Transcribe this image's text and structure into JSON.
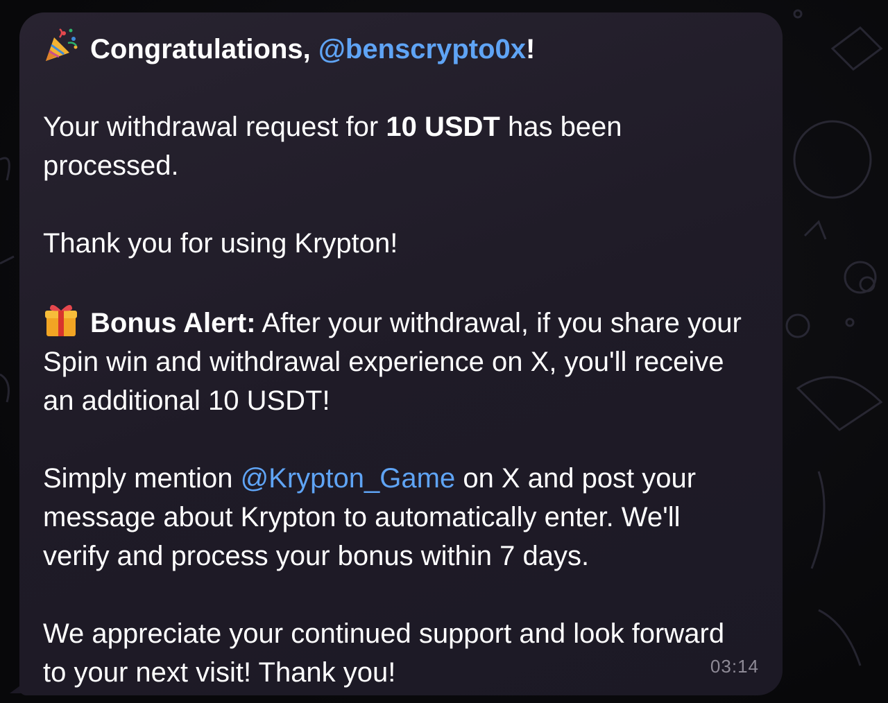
{
  "message": {
    "title": {
      "emoji": "party-popper-icon",
      "prefix": "Congratulations, ",
      "mention": "@benscrypto0x",
      "suffix": "!"
    },
    "withdrawal": {
      "prefix": "Your withdrawal request for ",
      "amount": "10 USDT",
      "suffix": " has been processed."
    },
    "thanks": "Thank you for using Krypton!",
    "bonus": {
      "emoji": "gift-icon",
      "label": "Bonus Alert:",
      "text": " After your withdrawal, if you share your Spin win and withdrawal experience on X, you'll receive an additional 10 USDT!"
    },
    "mention_para": {
      "prefix": "Simply mention ",
      "mention": "@Krypton_Game",
      "suffix": " on X and post your message about Krypton to automatically enter. We'll verify and process your bonus within 7 days."
    },
    "closing": "We appreciate your continued support and look forward to your next visit! Thank you!",
    "time": "03:14"
  },
  "colors": {
    "mention": "#5fa4f5",
    "bubble": "#1f1b27",
    "timestamp": "#8e8a96"
  }
}
